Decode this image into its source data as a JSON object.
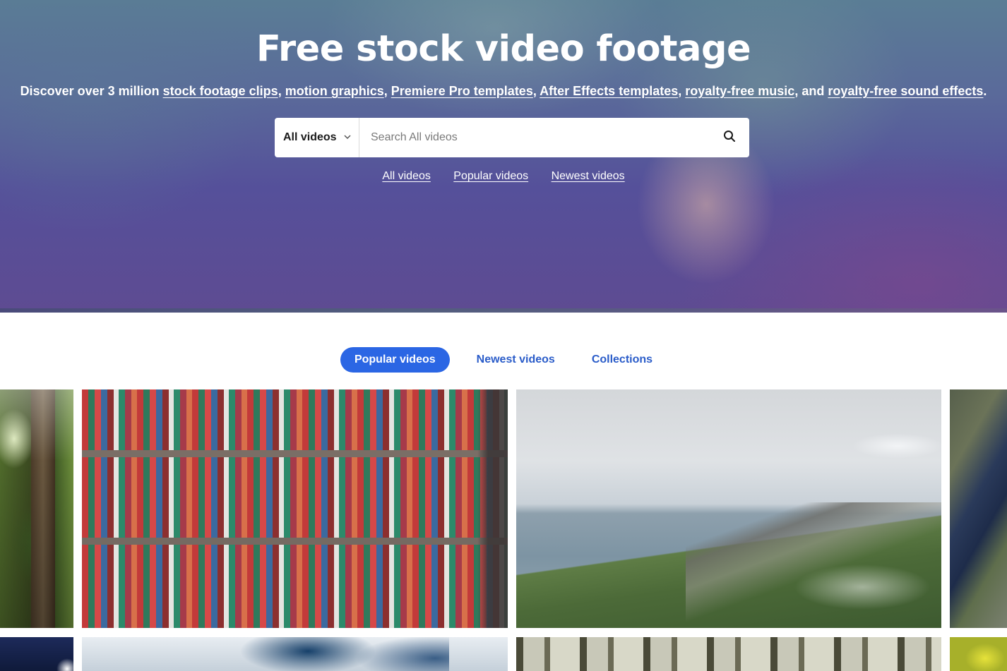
{
  "hero": {
    "title": "Free stock video footage",
    "subtitle": {
      "prefix": "Discover over 3 million ",
      "links": [
        "stock footage clips",
        "motion graphics",
        "Premiere Pro templates",
        "After Effects templates",
        "royalty-free music",
        "royalty-free sound effects"
      ],
      "sep": ", ",
      "and": ", and ",
      "end": "."
    }
  },
  "search": {
    "category": "All videos",
    "placeholder": "Search All videos",
    "button_icon": "search-icon"
  },
  "quick_links": [
    "All videos",
    "Popular videos",
    "Newest videos"
  ],
  "tabs": [
    {
      "label": "Popular videos",
      "active": true
    },
    {
      "label": "Newest videos",
      "active": false
    },
    {
      "label": "Collections",
      "active": false
    }
  ],
  "colors": {
    "accent": "#2b66e4",
    "tab_text": "#2a5cc9"
  }
}
